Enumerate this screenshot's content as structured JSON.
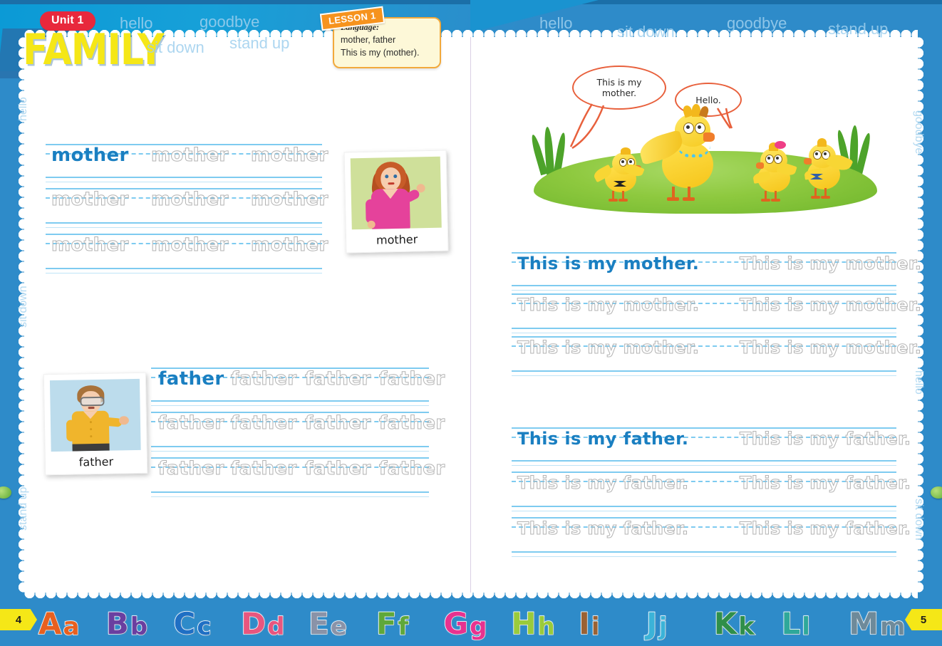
{
  "header": {
    "unit_badge": "Unit 1",
    "unit_title": "FAMILY",
    "lesson_tag": "LESSON 1",
    "language_label": "Language:",
    "language_line1": "mother, father",
    "language_line2": "This is my (mother).",
    "left_words": [
      "hello",
      "goodbye",
      "sit down",
      "stand up"
    ],
    "right_words": [
      "hello",
      "goodbye",
      "sit down",
      "stand up"
    ]
  },
  "margins": {
    "left_words": [
      "hello",
      "sit down",
      "stand up"
    ],
    "right_words": [
      "goodbye",
      "hello",
      "sit down"
    ]
  },
  "page_numbers": {
    "left": "4",
    "right": "5"
  },
  "left_page": {
    "word_mother": {
      "card_caption": "mother",
      "lines": [
        {
          "solid": "mother",
          "traced": [
            "mother",
            "mother"
          ]
        },
        {
          "solid": "",
          "traced": [
            "mother",
            "mother",
            "mother"
          ]
        },
        {
          "solid": "",
          "traced": [
            "mother",
            "mother",
            "mother"
          ]
        }
      ]
    },
    "word_father": {
      "card_caption": "father",
      "lines": [
        {
          "solid": "father",
          "traced": [
            "father",
            "father",
            "father"
          ]
        },
        {
          "solid": "",
          "traced": [
            "father",
            "father",
            "father",
            "father"
          ]
        },
        {
          "solid": "",
          "traced": [
            "father",
            "father",
            "father",
            "father"
          ]
        }
      ]
    }
  },
  "right_page": {
    "scene": {
      "bubble1": "This is my\nmother.",
      "bubble2": "Hello."
    },
    "sentence_mother": {
      "lines": [
        {
          "solid": "This is my mother.",
          "traced": [
            "This is my mother."
          ]
        },
        {
          "solid": "",
          "traced": [
            "This is my mother.",
            "This is my mother."
          ]
        },
        {
          "solid": "",
          "traced": [
            "This is my mother.",
            "This is my mother."
          ]
        }
      ]
    },
    "sentence_father": {
      "lines": [
        {
          "solid": "This is my father.",
          "traced": [
            "This is my father."
          ]
        },
        {
          "solid": "",
          "traced": [
            "This is my father.",
            "This is my father."
          ]
        },
        {
          "solid": "",
          "traced": [
            "This is my father.",
            "This is my father."
          ]
        }
      ]
    }
  },
  "alphabet": [
    {
      "cap": "A",
      "low": "a",
      "color": "#e8601f"
    },
    {
      "cap": "B",
      "low": "b",
      "color": "#6a3fa0"
    },
    {
      "cap": "C",
      "low": "c",
      "color": "#1f6fc4"
    },
    {
      "cap": "D",
      "low": "d",
      "color": "#e8567f"
    },
    {
      "cap": "E",
      "low": "e",
      "color": "#8a93a8"
    },
    {
      "cap": "F",
      "low": "f",
      "color": "#5fa83a"
    },
    {
      "cap": "G",
      "low": "g",
      "color": "#e8328f"
    },
    {
      "cap": "H",
      "low": "h",
      "color": "#9acb3b"
    },
    {
      "cap": "I",
      "low": "i",
      "color": "#9a6234"
    },
    {
      "cap": "J",
      "low": "j",
      "color": "#3bb3d8"
    },
    {
      "cap": "K",
      "low": "k",
      "color": "#2f8f4a"
    },
    {
      "cap": "L",
      "low": "l",
      "color": "#2fa89a"
    },
    {
      "cap": "M",
      "low": "m",
      "color": "#6e8a9a"
    }
  ],
  "colors": {
    "header_blue": "#2e8bc9",
    "title_yellow": "#f5e717",
    "badge_red": "#e8283c",
    "rule_blue": "#7ecbf0",
    "solid_text_blue": "#1a7fc1",
    "trace_gray": "#b3b3b3",
    "lesson_orange": "#f2a93b"
  }
}
